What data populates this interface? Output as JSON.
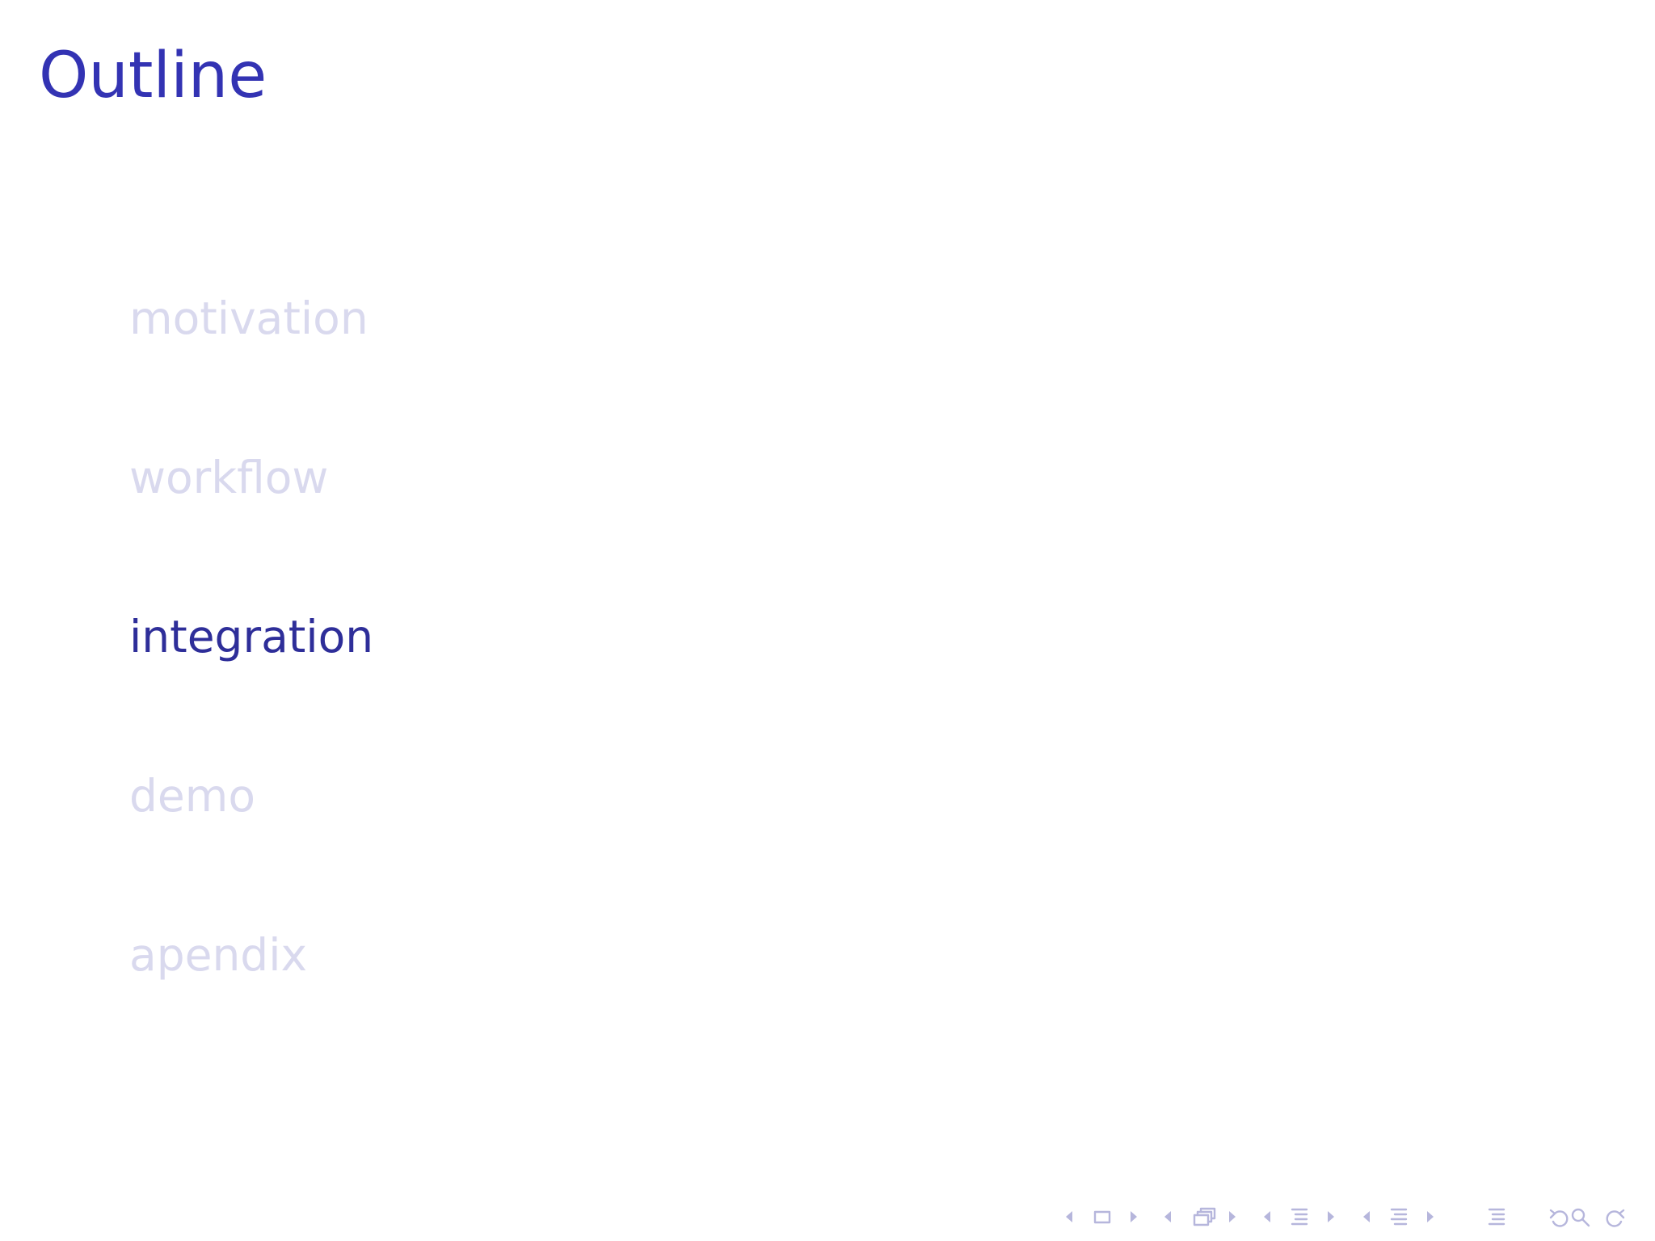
{
  "slide": {
    "title": "Outline"
  },
  "toc": {
    "items": [
      {
        "label": "motivation",
        "state": "inactive"
      },
      {
        "label": "workflow",
        "state": "inactive"
      },
      {
        "label": "integration",
        "state": "active"
      },
      {
        "label": "demo",
        "state": "inactive"
      },
      {
        "label": "apendix",
        "state": "inactive"
      }
    ]
  },
  "colors": {
    "title": "#3333b3",
    "active_item": "#2e2e99",
    "inactive_item": "#d9d9ee",
    "nav_symbols": "#b6b6dc"
  },
  "navigation": {
    "icons": [
      "arrow-left-icon",
      "frame-icon",
      "arrow-right-icon",
      "arrow-left-icon",
      "slide-stack-icon",
      "arrow-right-icon",
      "arrow-left-icon",
      "subsection-icon",
      "arrow-right-icon",
      "arrow-left-icon",
      "section-icon",
      "arrow-right-icon",
      "document-icon",
      "undo-icon",
      "search-icon",
      "redo-icon"
    ]
  }
}
